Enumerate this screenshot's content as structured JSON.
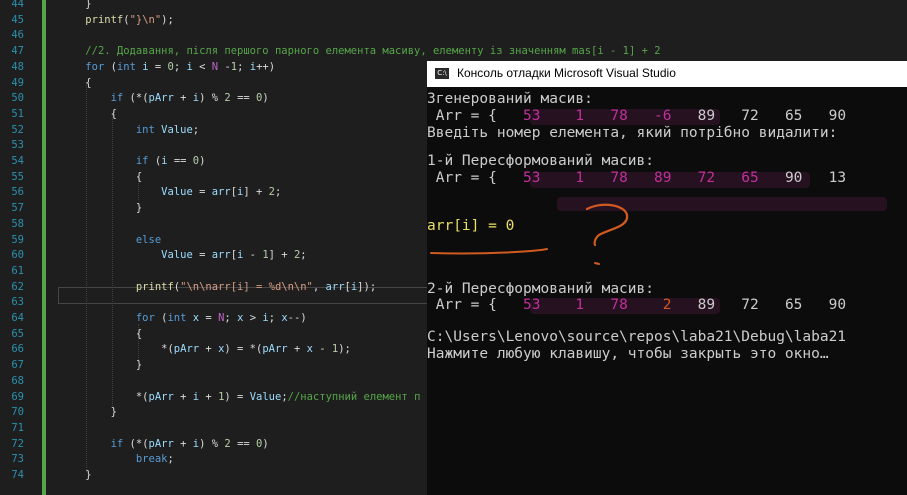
{
  "editor": {
    "lines": [
      {
        "n": "44",
        "t": "    }"
      },
      {
        "n": "45",
        "t": "    printf(\"}\\n\");"
      },
      {
        "n": "46",
        "t": ""
      },
      {
        "n": "47",
        "t": "    //2. Додавання, після першого парного елемента масиву, елементу із значенням mas[i - 1] + 2"
      },
      {
        "n": "48",
        "t": "    for (int i = 0; i < N -1; i++)"
      },
      {
        "n": "49",
        "t": "    {"
      },
      {
        "n": "50",
        "t": "        if (*(pArr + i) % 2 == 0)"
      },
      {
        "n": "51",
        "t": "        {"
      },
      {
        "n": "52",
        "t": "            int Value;"
      },
      {
        "n": "53",
        "t": ""
      },
      {
        "n": "54",
        "t": "            if (i == 0)"
      },
      {
        "n": "55",
        "t": "            {"
      },
      {
        "n": "56",
        "t": "                Value = arr[i] + 2;"
      },
      {
        "n": "57",
        "t": "            }"
      },
      {
        "n": "58",
        "t": ""
      },
      {
        "n": "59",
        "t": "            else"
      },
      {
        "n": "60",
        "t": "                Value = arr[i - 1] + 2;"
      },
      {
        "n": "61",
        "t": ""
      },
      {
        "n": "62",
        "t": "            printf(\"\\n\\narr[i] = %d\\n\\n\", arr[i]);"
      },
      {
        "n": "63",
        "t": ""
      },
      {
        "n": "64",
        "t": "            for (int x = N; x > i; x--)"
      },
      {
        "n": "65",
        "t": "            {"
      },
      {
        "n": "66",
        "t": "                *(pArr + x) = *(pArr + x - 1);"
      },
      {
        "n": "67",
        "t": "            }"
      },
      {
        "n": "68",
        "t": ""
      },
      {
        "n": "69",
        "t": "            *(pArr + i + 1) = Value;//наступний елемент п"
      },
      {
        "n": "70",
        "t": "        }"
      },
      {
        "n": "71",
        "t": ""
      },
      {
        "n": "72",
        "t": "        if (*(pArr + i) % 2 == 0)"
      },
      {
        "n": "73",
        "t": "            break;"
      },
      {
        "n": "74",
        "t": "    }"
      }
    ]
  },
  "console": {
    "title": "Консоль отладки Microsoft Visual Studio",
    "icon_text": "C:\\",
    "l1": "Згенерований масив:",
    "l2_prefix": " Arr = {  ",
    "l2_hl": " 53    1   78   -6",
    "l2_rest": "   89   72   65   90",
    "l3": "Введіть номер елемента, який потрібно видалити: ",
    "l4": "",
    "l5": "1-й Пересформований масив:",
    "l6_prefix": " Arr = {  ",
    "l6_hl": " 53    1   78   89   72   65",
    "l6_rest": "   90   13",
    "l7": "arr[i] = 0",
    "l8": "2-й Пересформований масив:",
    "l9_prefix": " Arr = {  ",
    "l9_hl": " 53    1   78",
    "l9_two": "    2",
    "l9_rest": "   89   72   65   90",
    "l10": "C:\\Users\\Lenovo\\source\\repos\\laba21\\Debug\\laba21",
    "l11": "Нажмите любую клавишу, чтобы закрыть это окно…"
  },
  "colors": {
    "accent_magenta": "#c0309a",
    "annotation": "#d05a20",
    "highlight_yellow": "#e8e060"
  }
}
